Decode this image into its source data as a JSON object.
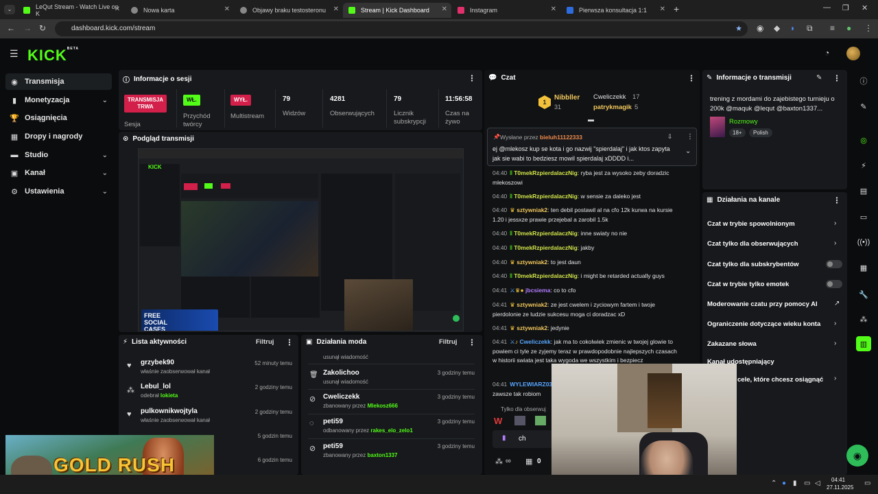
{
  "browser": {
    "tabs": [
      {
        "label": "LeQut Stream - Watch Live on K",
        "color": "#53fc18"
      },
      {
        "label": "Nowa karta",
        "color": "#888888"
      },
      {
        "label": "Objawy braku testosteronu",
        "color": "#888888"
      },
      {
        "label": "Stream | Kick Dashboard",
        "color": "#53fc18"
      },
      {
        "label": "Instagram",
        "color": "#e1306c"
      },
      {
        "label": "Pierwsza konsultacja 1:1",
        "color": "#2d6cdf"
      }
    ],
    "url": "dashboard.kick.com/stream"
  },
  "kick": {
    "logo": "KICK",
    "logo_badge": "BETA"
  },
  "sidebar": {
    "items": [
      {
        "label": "Transmisja",
        "icon": "broadcast-icon"
      },
      {
        "label": "Monetyzacja",
        "icon": "dollar-icon"
      },
      {
        "label": "Osiągnięcia",
        "icon": "trophy-icon"
      },
      {
        "label": "Dropy i nagrody",
        "icon": "gift-icon"
      },
      {
        "label": "Studio",
        "icon": "studio-icon"
      },
      {
        "label": "Kanał",
        "icon": "channel-icon"
      },
      {
        "label": "Ustawienia",
        "icon": "gear-icon"
      }
    ]
  },
  "session": {
    "title": "Informacje o sesji",
    "badge_live": "TRANSMISJA TRWA",
    "badge_live_sub": "Sesja",
    "badge_on": "WŁ.",
    "badge_on_sub": "Przychód twórcy",
    "badge_off": "WYŁ.",
    "badge_off_sub": "Multistream",
    "viewers_value": "79",
    "viewers_label": "Widzów",
    "followers_value": "4281",
    "followers_label": "Obserwujących",
    "subs_value": "79",
    "subs_label": "Licznik subskrypcji",
    "live_time_value": "11:56:58",
    "live_time_label": "Czas na żywo"
  },
  "preview": {
    "title": "Podgląd transmisji",
    "overlay_text": "FREE SOCIAL CASES"
  },
  "activity": {
    "title": "Lista aktywności",
    "filter": "Filtruj",
    "items": [
      {
        "name": "grzybek90",
        "sub": "właśnie zaobserwował kanał",
        "time": "52 minuty temu"
      },
      {
        "name": "Lebul_lol",
        "sub": "odebrał lokieta",
        "time": "2 godziny temu"
      },
      {
        "name": "pulkownikwojtyla",
        "sub": "właśnie zaobserwował kanał",
        "time": "2 godziny temu"
      },
      {
        "name": "",
        "sub": "",
        "time": "5 godzin temu"
      },
      {
        "name": "",
        "sub": "",
        "time": "6 godzin temu"
      }
    ]
  },
  "modactions": {
    "title": "Działania moda",
    "filter": "Filtruj",
    "items": [
      {
        "name": "",
        "sub": "usunął wiadomość",
        "time": ""
      },
      {
        "name": "Zakolichoo",
        "sub": "usunął wiadomość",
        "time": "3 godziny temu"
      },
      {
        "name": "Cweliczekk",
        "sub": "zbanowany przez Mlekosz666",
        "time": "3 godziny temu"
      },
      {
        "name": "peti59",
        "sub": "odbanowany przez rakes_elo_zelo1",
        "time": "3 godziny temu"
      },
      {
        "name": "peti59",
        "sub": "zbanowany przez baxton1337",
        "time": "3 godziny temu"
      }
    ]
  },
  "chat": {
    "title": "Czat",
    "leaders": {
      "first": "Nibbller",
      "first_count": "31",
      "second": "Cweliczekk",
      "second_count": "17",
      "third": "patrykmagik",
      "third_count": "5"
    },
    "pinned_by_label": "Wysłane przez",
    "pinned_by": "bieluh11122333",
    "pinned_text": "ej @mlekosz kup se kota i go nazwij \"spierdalaj\" i jak ktos zapyta jak sie wabi to bedziesz mowil spierdalaj xDDDD i...",
    "messages": [
      {
        "ts": "04:40",
        "user": "T0mekRzpierdalaczNig",
        "cls": "",
        "text": "ryba jest za wysoko zeby doradzic mlekoszowi"
      },
      {
        "ts": "04:40",
        "user": "T0mekRzpierdalaczNig",
        "cls": "",
        "text": "w sensie za daleko jest"
      },
      {
        "ts": "04:40",
        "user": "sztywniak2",
        "cls": "gold",
        "text": "ten debil postawil al na cfo 12k kurwa na kursie 1.20 i jessxze prawie przejebal a zarobil 1.5k"
      },
      {
        "ts": "04:40",
        "user": "T0mekRzpierdalaczNig",
        "cls": "",
        "text": "inne swiaty no nie"
      },
      {
        "ts": "04:40",
        "user": "T0mekRzpierdalaczNig",
        "cls": "",
        "text": "jakby"
      },
      {
        "ts": "04:40",
        "user": "sztywniak2",
        "cls": "gold",
        "text": "to jest daun"
      },
      {
        "ts": "04:40",
        "user": "T0mekRzpierdalaczNig",
        "cls": "",
        "text": "i might be retarded actually guys"
      },
      {
        "ts": "04:41",
        "user": "jbcsiema",
        "cls": "purple",
        "text": "co to cfo"
      },
      {
        "ts": "04:41",
        "user": "sztywniak2",
        "cls": "gold",
        "text": "ze jest cwelem i zyciowym fartem i twoje pierdolonie ze ludzie sukcesu moga ci doradzac xD"
      },
      {
        "ts": "04:41",
        "user": "sztywniak2",
        "cls": "gold",
        "text": "jedynie"
      },
      {
        "ts": "04:41",
        "user": "Cweliczekk",
        "cls": "blue",
        "text": "jak ma to cokolwiek zmienic w twojej glowie to powiem ci tyle ze zyjemy teraz w prawdopodobnie najlepszych czasach w historii swiata jest taka wygoda we wszystkim i bezpiecz"
      },
      {
        "ts": "04:41",
        "user": "WYLEWIARZ03",
        "cls": "blue",
        "text": "zawsze tak robiom"
      }
    ],
    "followers_only": "Tylko dla obserwuj",
    "input_value": "ch",
    "bottom_count": "0"
  },
  "stream_info": {
    "title": "Informacje o transmisji",
    "stream_title": "trening z mordami do zajebistego turnieju o 200k @maquk @lequt @baxton1337...",
    "category": "Rozmowy",
    "age_badge": "18+",
    "language_badge": "Polish"
  },
  "channel_actions": {
    "title": "Działania na kanale",
    "items": [
      {
        "label": "Czat w trybie spowolnionym",
        "type": "chevron"
      },
      {
        "label": "Czat tylko dla obserwujących",
        "type": "chevron"
      },
      {
        "label": "Czat tylko dla subskrybentów",
        "type": "toggle"
      },
      {
        "label": "Czat w trybie tylko emotek",
        "type": "toggle"
      },
      {
        "label": "Moderowanie czatu przy pomocy AI",
        "type": "external"
      },
      {
        "label": "Ograniczenie dotyczące wieku konta",
        "type": "chevron"
      },
      {
        "label": "Zakazane słowa",
        "type": "chevron"
      },
      {
        "label": "Kanał udostępniający",
        "type": "none"
      },
      {
        "label": "cele, które chcesz osiągnąć",
        "type": "chevron"
      }
    ]
  },
  "overlays": {
    "game_banner": "GOLD RUSH"
  },
  "taskbar": {
    "time": "04:41",
    "date": "27.11.2025"
  },
  "colors": {
    "kick_green": "#53fc18",
    "live_red": "#d2204a",
    "panel_bg": "#17191c"
  }
}
